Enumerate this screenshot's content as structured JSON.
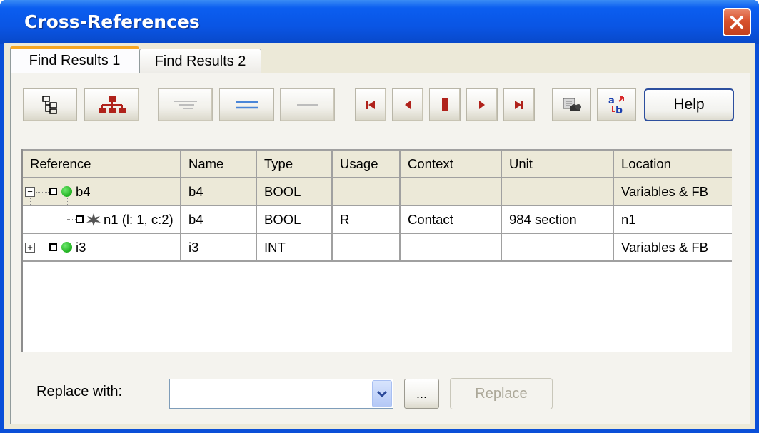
{
  "window": {
    "title": "Cross-References"
  },
  "tabs": [
    {
      "label": "Find Results 1",
      "active": true
    },
    {
      "label": "Find Results 2",
      "active": false
    }
  ],
  "toolbar": {
    "buttons": [
      {
        "icon": "tree-view-icon"
      },
      {
        "icon": "hierarchy-icon"
      },
      {
        "icon": "filter-lines-icon",
        "disabled": true
      },
      {
        "icon": "equal-lines-icon"
      },
      {
        "icon": "single-line-icon",
        "disabled": true
      },
      {
        "icon": "first-icon"
      },
      {
        "icon": "previous-icon"
      },
      {
        "icon": "stop-icon"
      },
      {
        "icon": "next-icon"
      },
      {
        "icon": "last-icon"
      },
      {
        "icon": "find-icon"
      },
      {
        "icon": "replace-ab-icon"
      }
    ],
    "help_label": "Help"
  },
  "grid": {
    "columns": [
      "Reference",
      "Name",
      "Type",
      "Usage",
      "Context",
      "Unit",
      "Location"
    ],
    "rows": [
      {
        "reference": "b4",
        "name": "b4",
        "type": "BOOL",
        "usage": "",
        "context": "",
        "unit": "",
        "location": "Variables & FB",
        "expander": "−"
      },
      {
        "reference": "n1 (l: 1, c:2)",
        "name": "b4",
        "type": "BOOL",
        "usage": "R",
        "context": "Contact",
        "unit": "984 section",
        "location": "n1"
      },
      {
        "reference": "i3",
        "name": "i3",
        "type": "INT",
        "usage": "",
        "context": "",
        "unit": "",
        "location": "Variables & FB",
        "expander": "+"
      }
    ]
  },
  "replace": {
    "label": "Replace with:",
    "value": "",
    "browse_label": "...",
    "button_label": "Replace"
  },
  "colors": {
    "titlebar": "#0a55e4",
    "dialog_bg": "#ece9d8",
    "close_button": "#d8512d",
    "active_tab_accent": "#f5a623",
    "status_dot": "#1fb01f"
  }
}
